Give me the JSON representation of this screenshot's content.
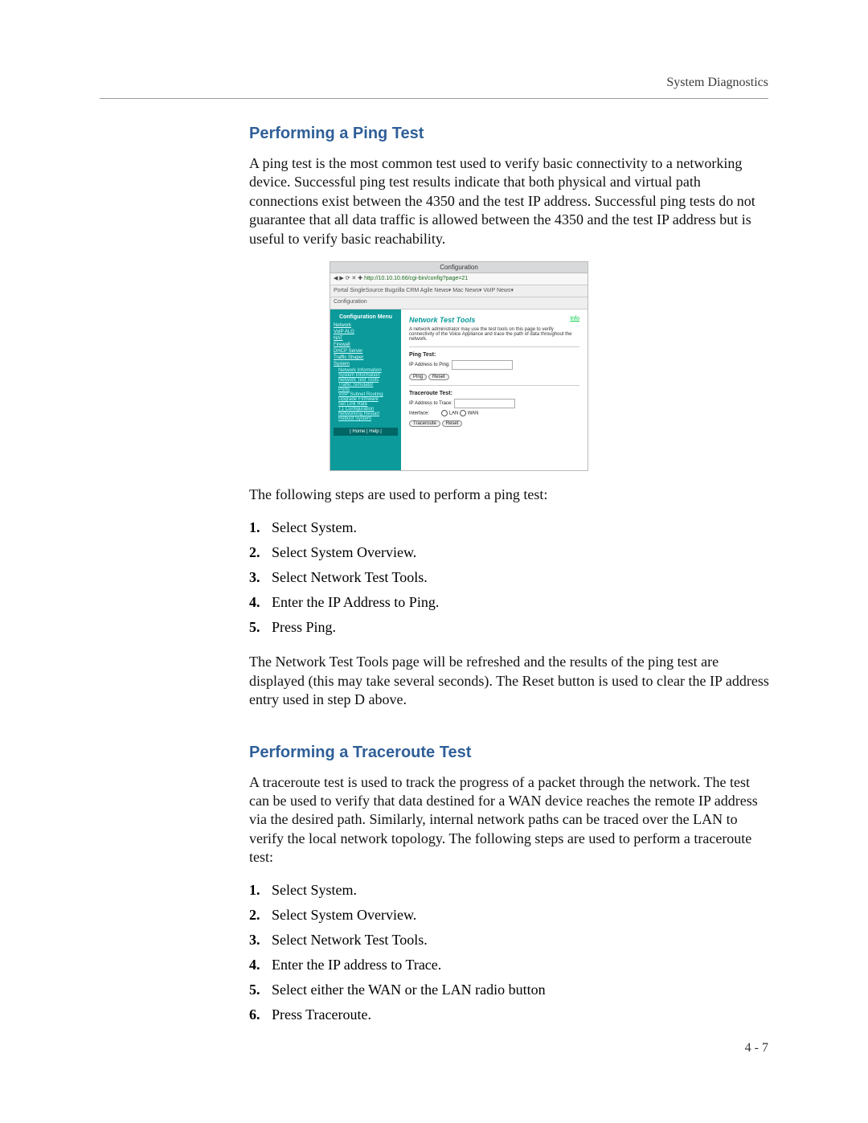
{
  "header": {
    "title": "System Diagnostics"
  },
  "footer": {
    "page": "4 - 7"
  },
  "section1": {
    "heading": "Performing a Ping Test",
    "para1": "A ping test is the most common test used to verify basic connectivity to a networking device. Successful ping test results indicate that both physical and virtual path connections exist between the 4350 and the test IP address. Successful ping tests do not guarantee that all data traffic is allowed between the 4350 and the test IP address but is useful to verify basic reachability.",
    "lead": "The following steps are used to perform a ping test:",
    "steps": [
      "Select System.",
      "Select System Overview.",
      "Select Network Test Tools.",
      "Enter the IP Address to Ping.",
      "Press Ping."
    ],
    "para2": "The Network Test Tools page will be refreshed and the results of the ping test are displayed (this may take several seconds). The Reset button is used to clear the IP address entry used in step D above."
  },
  "section2": {
    "heading": "Performing a Traceroute Test",
    "para1": "A traceroute test is used to track the progress of a packet through the network. The test can be used to verify that data destined for a WAN device reaches the remote IP address via the desired path. Similarly, internal network paths can be traced over the LAN to verify the local network topology. The following steps are used to perform a traceroute test:",
    "steps": [
      "Select System.",
      "Select System Overview.",
      "Select Network Test Tools.",
      "Enter the IP address to Trace.",
      "Select either the WAN or the LAN radio button",
      "Press Traceroute."
    ]
  },
  "screenshot": {
    "windowTitle": "Configuration",
    "url": "http://10.10.10.66/cgi-bin/config?page=21",
    "bookmarks": "Portal  SingleSource  Bugzilla  CRM  Agile  News▾  Mac News▾  VoIP News▾",
    "tab": "Configuration",
    "sidebar": {
      "title": "Configuration Menu",
      "items": [
        "Network",
        "VoIP ALG",
        "NAT",
        "Firewall",
        "DHCP Server",
        "Traffic Shaper",
        "System"
      ],
      "subitems": [
        "Network Information",
        "System Information",
        "Network Test Tools",
        "Traffic Simulator",
        "Ports",
        "VoIP Subnet Routing",
        "Upgrade Firmware",
        "Set Link Rate",
        "T1 Configuration",
        "Networking Restart",
        "Reboot System"
      ],
      "footer": "| Home | Help |"
    },
    "panel": {
      "title": "Network Test Tools",
      "info": "Info",
      "desc": "A network administrator may use the test tools on this page to verify connectivity of the Voice Appliance and trace the path of data throughout the network.",
      "ping": {
        "title": "Ping Test:",
        "label": "IP Address to Ping:",
        "btn1": "Ping",
        "btn2": "Reset"
      },
      "trace": {
        "title": "Traceroute Test:",
        "label": "IP Address to Trace:",
        "iface": "Interface:",
        "opt1": "LAN",
        "opt2": "WAN",
        "btn1": "Traceroute",
        "btn2": "Reset"
      }
    }
  }
}
